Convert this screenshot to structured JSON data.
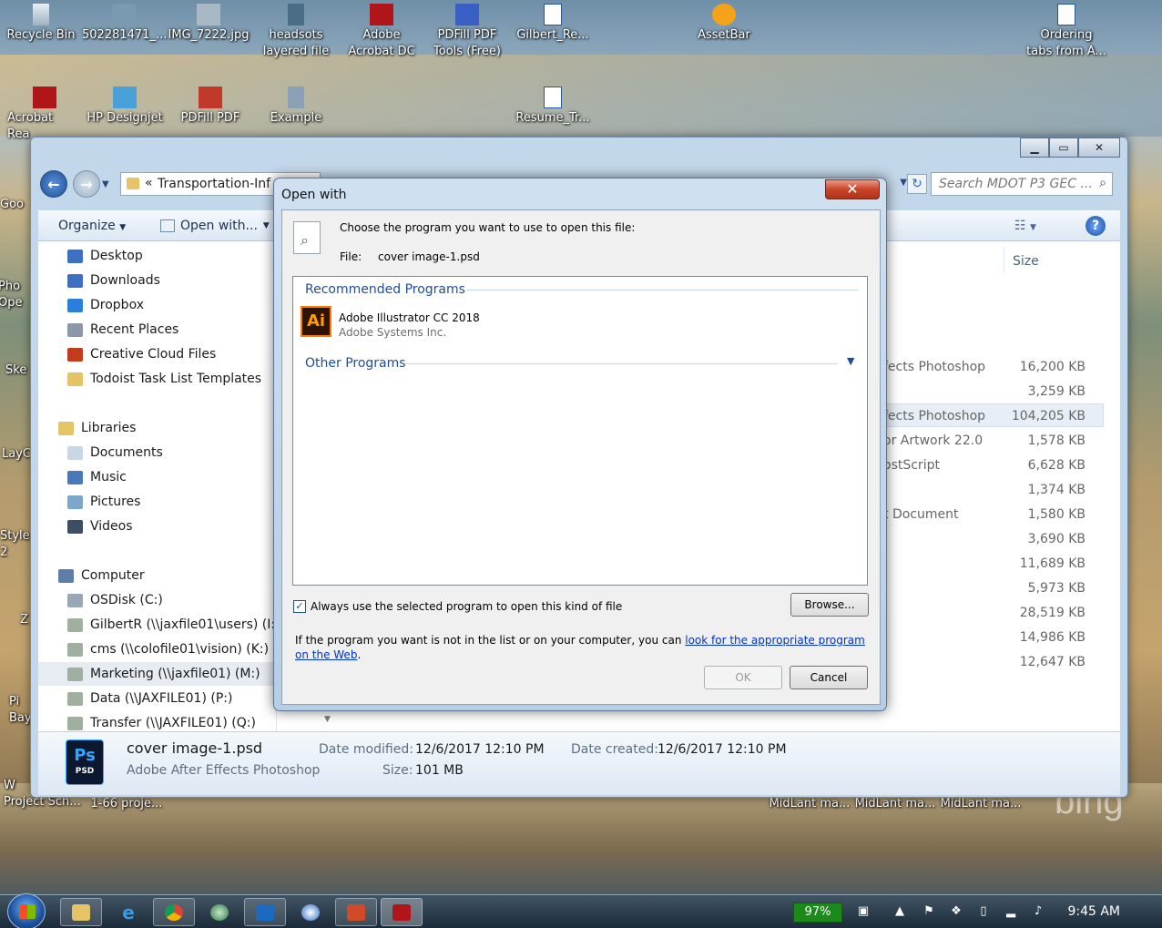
{
  "desktop": {
    "icons_row1": [
      "Recycle Bin",
      "502281471_...",
      "IMG_7222.jpg",
      "headsots\nlayered file",
      "Adobe\nAcrobat DC",
      "PDFill PDF\nTools (Free)",
      "Gilbert_Re...",
      "AssetBar",
      "Ordering\ntabs from A..."
    ],
    "icons_row2": [
      "Acrobat\nRea",
      "HP Designjet",
      "PDFill PDF",
      "Example",
      "Resume_Tr..."
    ],
    "left_edge_labels": [
      "Goo",
      "Pho\nOpe",
      "Ske",
      "LayC",
      "Style\n2",
      "Z",
      "Pi\nBay",
      "W\nProject Sch..."
    ],
    "bottom_labels": [
      "1-66 proje...",
      "MidLant ma...",
      "MidLant ma...",
      "MidLant ma..."
    ],
    "watermark": "bing"
  },
  "explorer": {
    "address": "Transportation-Inf",
    "address_prefix": "«",
    "search_placeholder": "Search MDOT P3 GEC ...",
    "toolbar": {
      "organize": "Organize",
      "open_with": "Open with..."
    },
    "nav": [
      {
        "label": "Desktop",
        "color": "#3f6fc0"
      },
      {
        "label": "Downloads",
        "color": "#3f6fc0"
      },
      {
        "label": "Dropbox",
        "color": "#2a7fd8"
      },
      {
        "label": "Recent Places",
        "color": "#8c98a8"
      },
      {
        "label": "Creative Cloud Files",
        "color": "#c23b1c"
      },
      {
        "label": "Todoist Task List Templates",
        "color": "#e5c467"
      }
    ],
    "libraries": {
      "header": "Libraries",
      "items": [
        "Documents",
        "Music",
        "Pictures",
        "Videos"
      ]
    },
    "computer": {
      "header": "Computer",
      "items": [
        "OSDisk (C:)",
        "GilbertR (\\\\jaxfile01\\users) (I:)",
        "cms (\\\\colofile01\\vision) (K:)",
        "Marketing (\\\\jaxfile01) (M:)",
        "Data (\\\\JAXFILE01) (P:)",
        "Transfer (\\\\JAXFILE01) (Q:)"
      ]
    },
    "size_header": "Size",
    "rows": [
      {
        "type": "fects Photoshop",
        "size": "16,200 KB"
      },
      {
        "type": "",
        "size": "3,259 KB"
      },
      {
        "type": "fects Photoshop",
        "size": "104,205 KB"
      },
      {
        "type": "or Artwork 22.0",
        "size": "1,578 KB"
      },
      {
        "type": "ostScript",
        "size": "6,628 KB"
      },
      {
        "type": "",
        "size": "1,374 KB"
      },
      {
        "type": "t Document",
        "size": "1,580 KB"
      },
      {
        "type": "",
        "size": "3,690 KB"
      },
      {
        "type": "",
        "size": "11,689 KB"
      },
      {
        "type": "",
        "size": "5,973 KB"
      },
      {
        "type": "",
        "size": "28,519 KB"
      },
      {
        "type": "",
        "size": "14,986 KB"
      },
      {
        "type": "",
        "size": "12,647 KB"
      }
    ],
    "details": {
      "filename": "cover image-1.psd",
      "filetype": "Adobe After Effects Photoshop",
      "modified_label": "Date modified:",
      "modified": "12/6/2017 12:10 PM",
      "created_label": "Date created:",
      "created": "12/6/2017 12:10 PM",
      "size_label": "Size:",
      "size": "101 MB",
      "icon_text": "Ps",
      "icon_sub": "PSD"
    }
  },
  "dialog": {
    "title": "Open with",
    "close": "✕",
    "prompt": "Choose the program you want to use to open this file:",
    "file_label": "File:",
    "file_name": "cover image-1.psd",
    "recommended_header": "Recommended Programs",
    "program_name": "Adobe Illustrator CC 2018",
    "program_publisher": "Adobe Systems Inc.",
    "program_icon": "Ai",
    "other_header": "Other Programs",
    "always_use": "Always use the selected program to open this kind of file",
    "always_use_checked": true,
    "browse": "Browse...",
    "hint_text": "If the program you want is not in the list or on your computer, you can",
    "hint_link": "look for the appropriate program on the Web",
    "hint_end": ".",
    "ok": "OK",
    "cancel": "Cancel"
  },
  "taskbar": {
    "battery": "97%",
    "clock": "9:45 AM"
  }
}
